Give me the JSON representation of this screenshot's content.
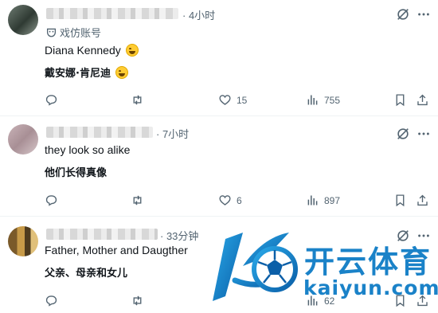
{
  "posts": [
    {
      "time": "· 4小时",
      "badge": "戏仿账号",
      "lines": [
        "Diana Kennedy",
        "戴安娜·肯尼迪"
      ],
      "stats": {
        "replies": "",
        "reposts": "",
        "likes": "15",
        "views": "755"
      }
    },
    {
      "time": "· 7小时",
      "lines": [
        "they look so alike",
        "他们长得真像"
      ],
      "stats": {
        "replies": "",
        "reposts": "",
        "likes": "6",
        "views": "897"
      }
    },
    {
      "time": "· 33分钟",
      "lines": [
        "Father, Mother and Daugther",
        "父亲、母亲和女儿"
      ],
      "stats": {
        "replies": "",
        "reposts": "",
        "likes": "",
        "views": "62"
      }
    }
  ],
  "watermark": {
    "brand_cn": "开云体育",
    "brand_en": "kaiyun.com"
  },
  "colors": {
    "text": "#0f1419",
    "muted": "#536471",
    "watermark": "#1a82c8"
  },
  "icons": [
    "grok-icon",
    "more-icon",
    "reply-icon",
    "repost-icon",
    "like-icon",
    "views-icon",
    "bookmark-icon",
    "share-icon"
  ]
}
